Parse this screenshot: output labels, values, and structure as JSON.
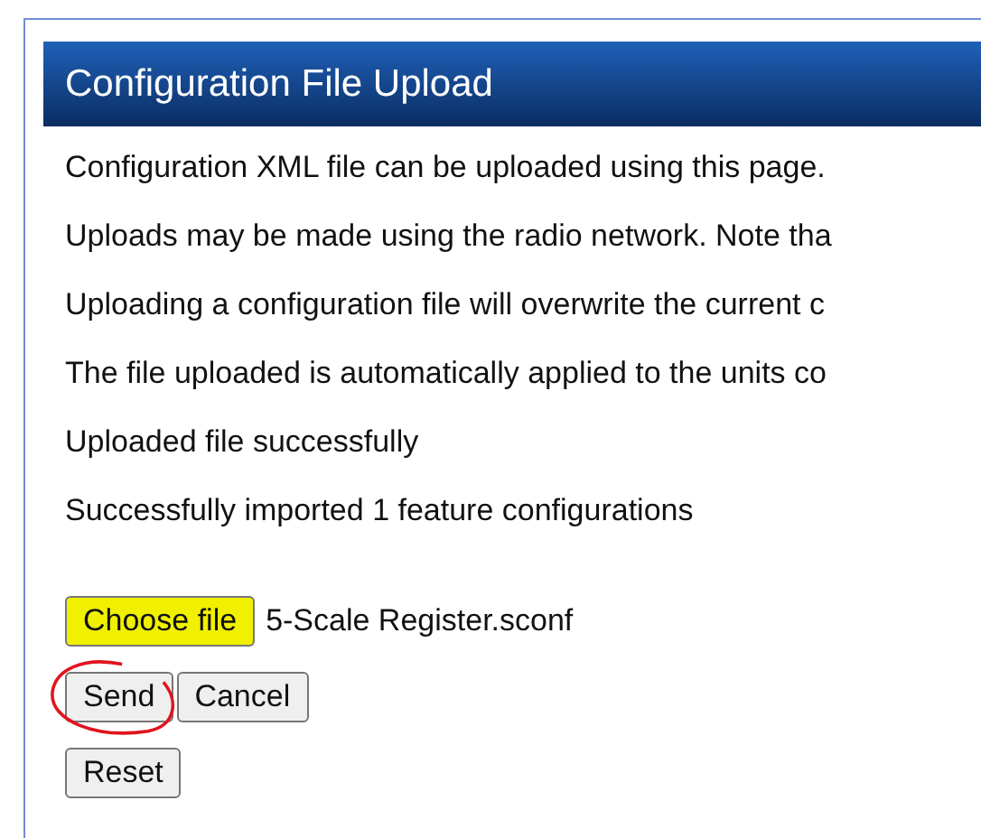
{
  "panel": {
    "title": "Configuration File Upload"
  },
  "messages": [
    "Configuration XML file can be uploaded using this page.",
    "Uploads may be made using the radio network. Note tha",
    "Uploading a configuration file will overwrite the current c",
    "The file uploaded is automatically applied to the units co",
    "Uploaded file successfully",
    "Successfully imported 1 feature configurations"
  ],
  "file_input": {
    "button": "Choose file",
    "highlighted": true,
    "filename": "5-Scale Register.sconf"
  },
  "action_rows": [
    [
      {
        "label": "Send",
        "circled": true
      },
      {
        "label": "Cancel",
        "circled": false
      }
    ],
    [
      {
        "label": "Reset",
        "circled": false
      }
    ]
  ]
}
